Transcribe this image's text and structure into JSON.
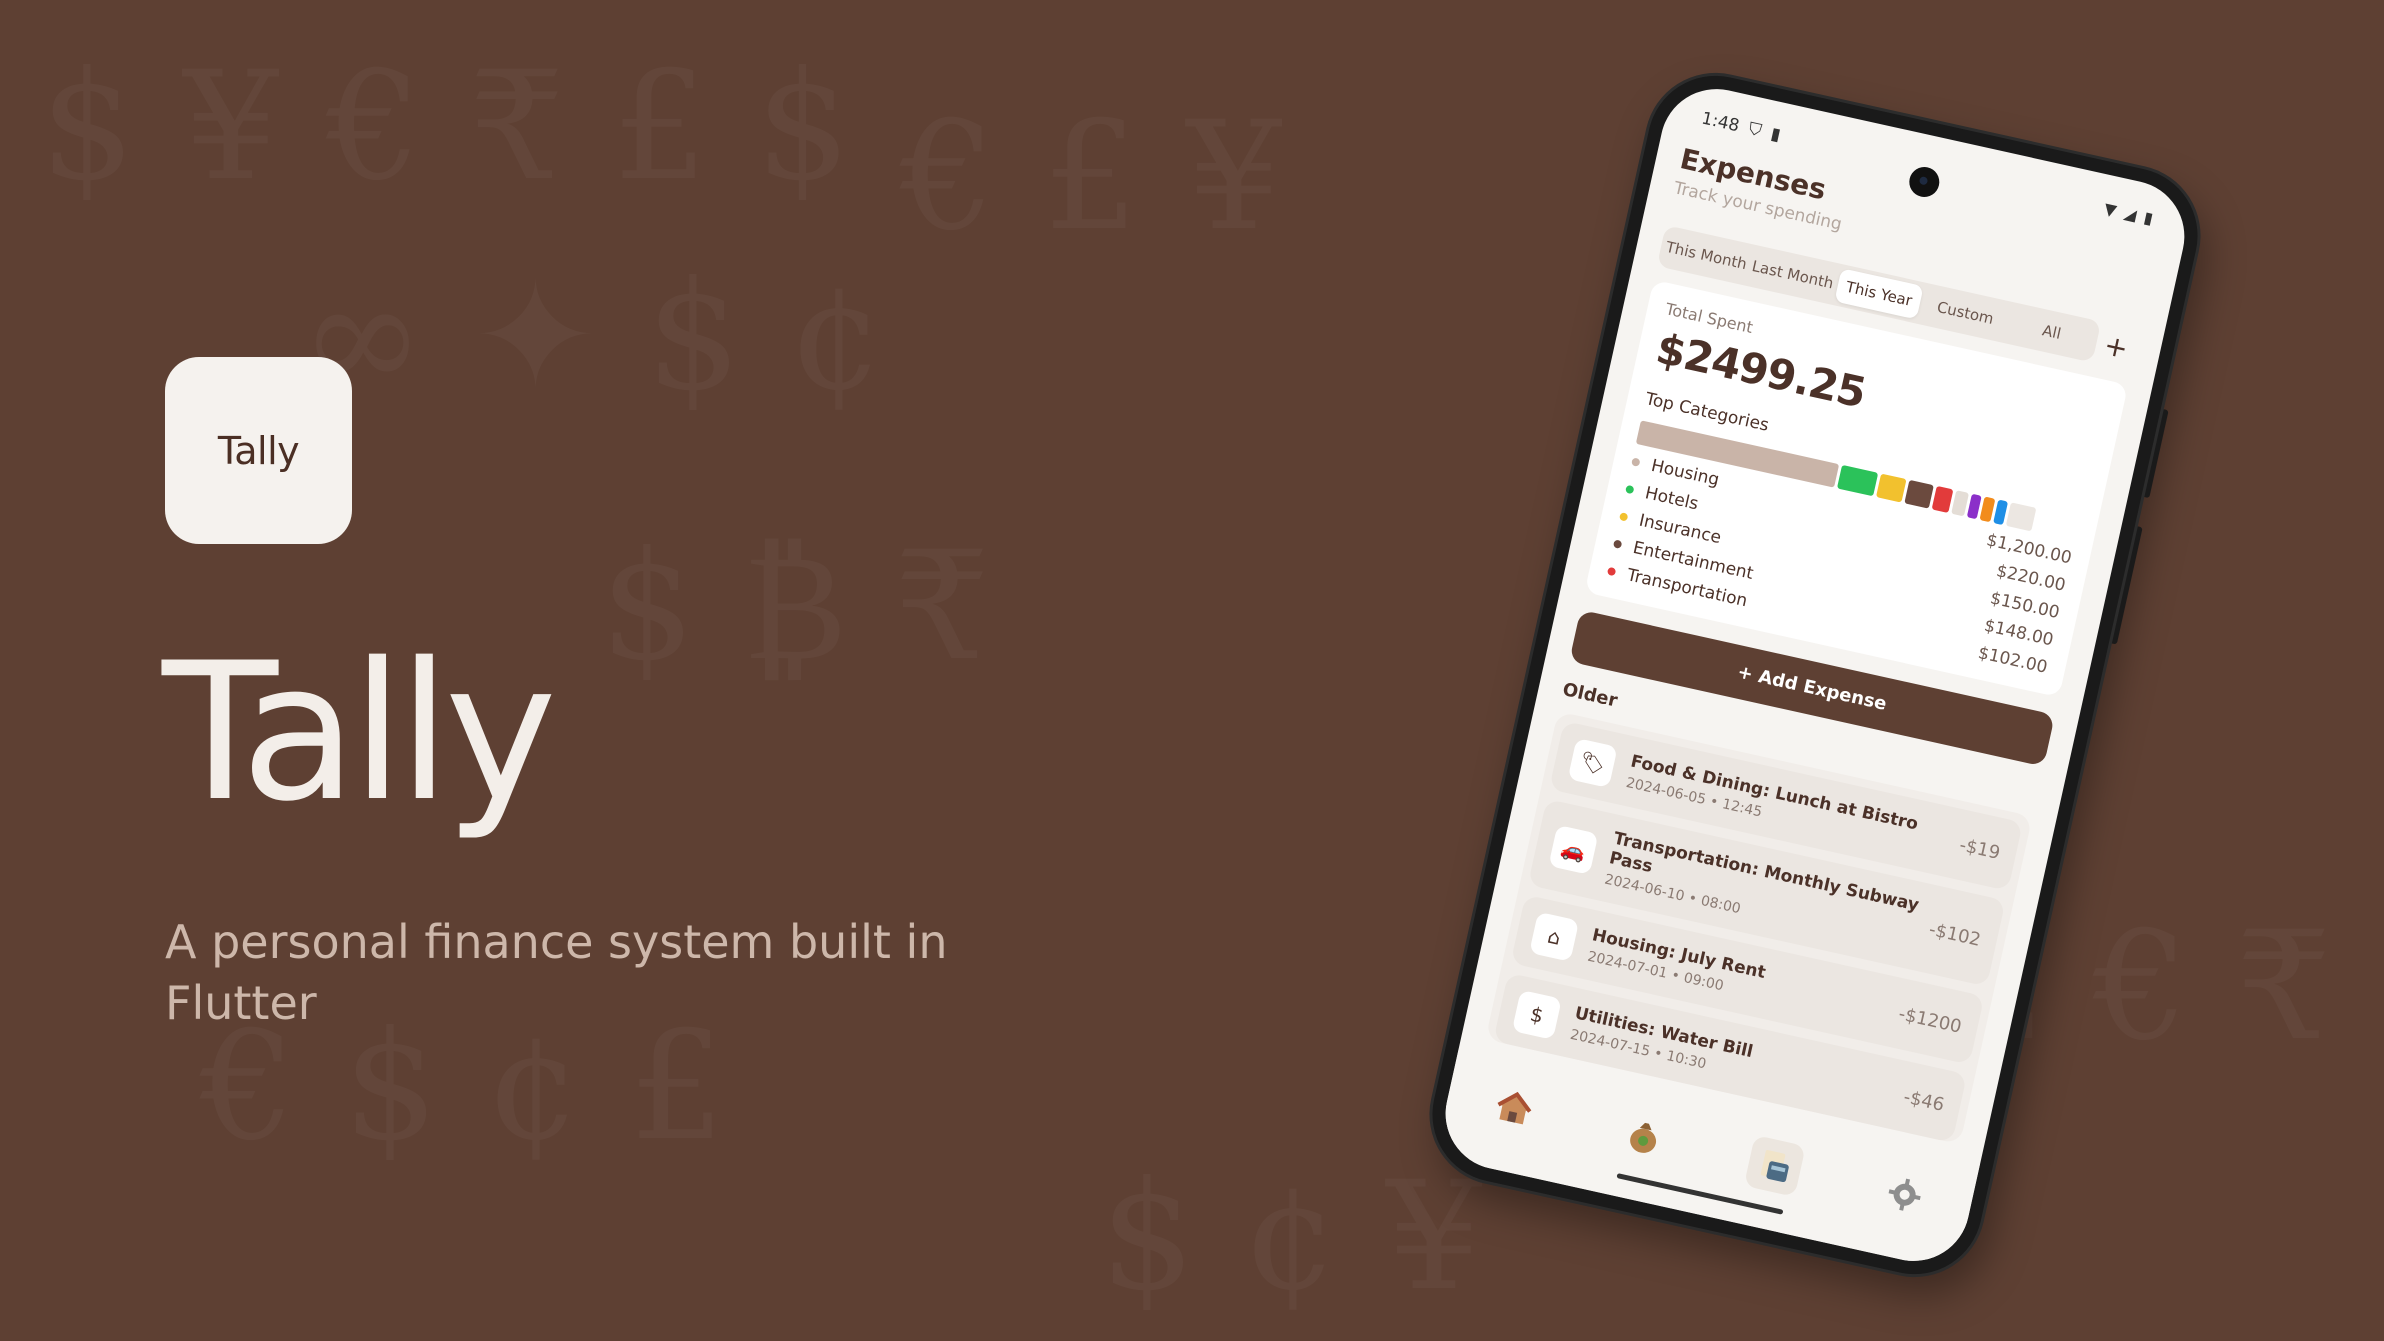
{
  "hero": {
    "icon_label": "Tally",
    "title": "Tally",
    "subtitle": "A personal finance system built in Flutter"
  },
  "colors": {
    "background": "#5e4033",
    "accent": "#5e4033",
    "text_dark": "#4b3128"
  },
  "status_bar": {
    "time": "1:48",
    "left_icons": [
      "shield-icon",
      "sim-card-icon"
    ],
    "right_icons": [
      "wifi-icon",
      "signal-icon",
      "battery-icon"
    ]
  },
  "screen": {
    "title": "Expenses",
    "subtitle": "Track your spending",
    "tabs": [
      {
        "label": "This Month",
        "active": false
      },
      {
        "label": "Last Month",
        "active": false
      },
      {
        "label": "This Year",
        "active": true
      },
      {
        "label": "Custom",
        "active": false
      },
      {
        "label": "All",
        "active": false
      }
    ],
    "add_icon": "+",
    "summary": {
      "total_label": "Total Spent",
      "total_value": "$2499.25",
      "top_categories_label": "Top Categories",
      "bar_segments": [
        {
          "color": "#c9b4a8",
          "share": 0.48
        },
        {
          "color": "#2bc25a",
          "share": 0.088
        },
        {
          "color": "#f2c12e",
          "share": 0.06
        },
        {
          "color": "#6b4a3e",
          "share": 0.059
        },
        {
          "color": "#e23b3b",
          "share": 0.041
        },
        {
          "color": "#e4ddd6",
          "share": 0.03
        },
        {
          "color": "#8b2fc9",
          "share": 0.025
        },
        {
          "color": "#f28c1c",
          "share": 0.025
        },
        {
          "color": "#1f8fe6",
          "share": 0.025
        },
        {
          "color": "#ece7e2",
          "share": 0.06
        }
      ],
      "categories": [
        {
          "name": "Housing",
          "amount": "$1,200.00",
          "color": "#c9b4a8"
        },
        {
          "name": "Hotels",
          "amount": "$220.00",
          "color": "#2bc25a"
        },
        {
          "name": "Insurance",
          "amount": "$150.00",
          "color": "#f2c12e"
        },
        {
          "name": "Entertainment",
          "amount": "$148.00",
          "color": "#6b4a3e"
        },
        {
          "name": "Transportation",
          "amount": "$102.00",
          "color": "#e23b3b"
        }
      ]
    },
    "add_button": "+ Add Expense",
    "section_label": "Older",
    "expenses": [
      {
        "icon": "tag-icon",
        "glyph": "🏷",
        "title": "Food & Dining: Lunch at Bistro",
        "date": "2024-06-05 • 12:45",
        "amount": "-$19"
      },
      {
        "icon": "car-icon",
        "glyph": "🚗",
        "title": "Transportation: Monthly Subway Pass",
        "date": "2024-06-10 • 08:00",
        "amount": "-$102"
      },
      {
        "icon": "home-icon",
        "glyph": "⌂",
        "title": "Housing: July Rent",
        "date": "2024-07-01 • 09:00",
        "amount": "-$1200"
      },
      {
        "icon": "receipt-icon",
        "glyph": "$",
        "title": "Utilities: Water Bill",
        "date": "2024-07-15 • 10:30",
        "amount": "-$46"
      }
    ],
    "nav": [
      {
        "name": "nav-home-icon",
        "glyph": "🏠"
      },
      {
        "name": "nav-wallet-icon",
        "glyph": "💰"
      },
      {
        "name": "nav-expenses-icon",
        "glyph": "🧾"
      },
      {
        "name": "nav-settings-icon",
        "glyph": "⚙"
      }
    ]
  }
}
